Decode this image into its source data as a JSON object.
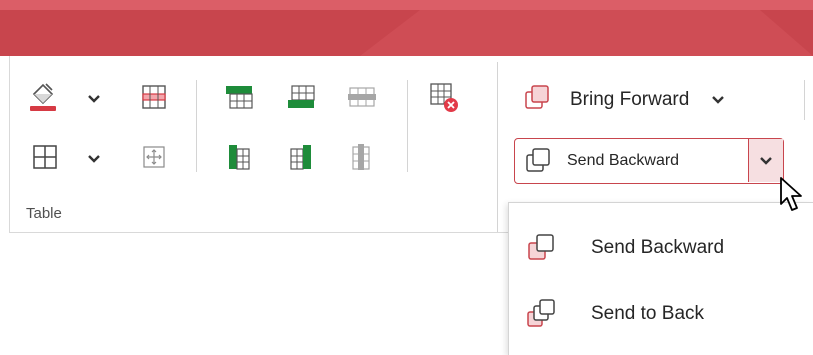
{
  "colors": {
    "accent": "#c8454d",
    "fill_green": "#1e8c3a",
    "disabled_gray": "#a6a6a6"
  },
  "table_group": {
    "label": "Table",
    "icons": [
      "shading-icon",
      "chevron-down-icon",
      "delete-row-icon",
      "insert-rows-above-icon",
      "insert-rows-below-icon",
      "delete-rows-icon",
      "delete-table-icon",
      "borders-icon",
      "chevron-down-icon",
      "move-table-icon",
      "insert-columns-left-icon",
      "insert-columns-right-icon",
      "delete-columns-icon"
    ]
  },
  "arrange": {
    "bring_forward_label": "Bring Forward",
    "send_backward_label": "Send Backward"
  },
  "dropdown_menu": {
    "items": [
      {
        "label": "Send Backward",
        "icon": "send-backward-icon"
      },
      {
        "label": "Send to Back",
        "icon": "send-to-back-icon"
      }
    ]
  }
}
